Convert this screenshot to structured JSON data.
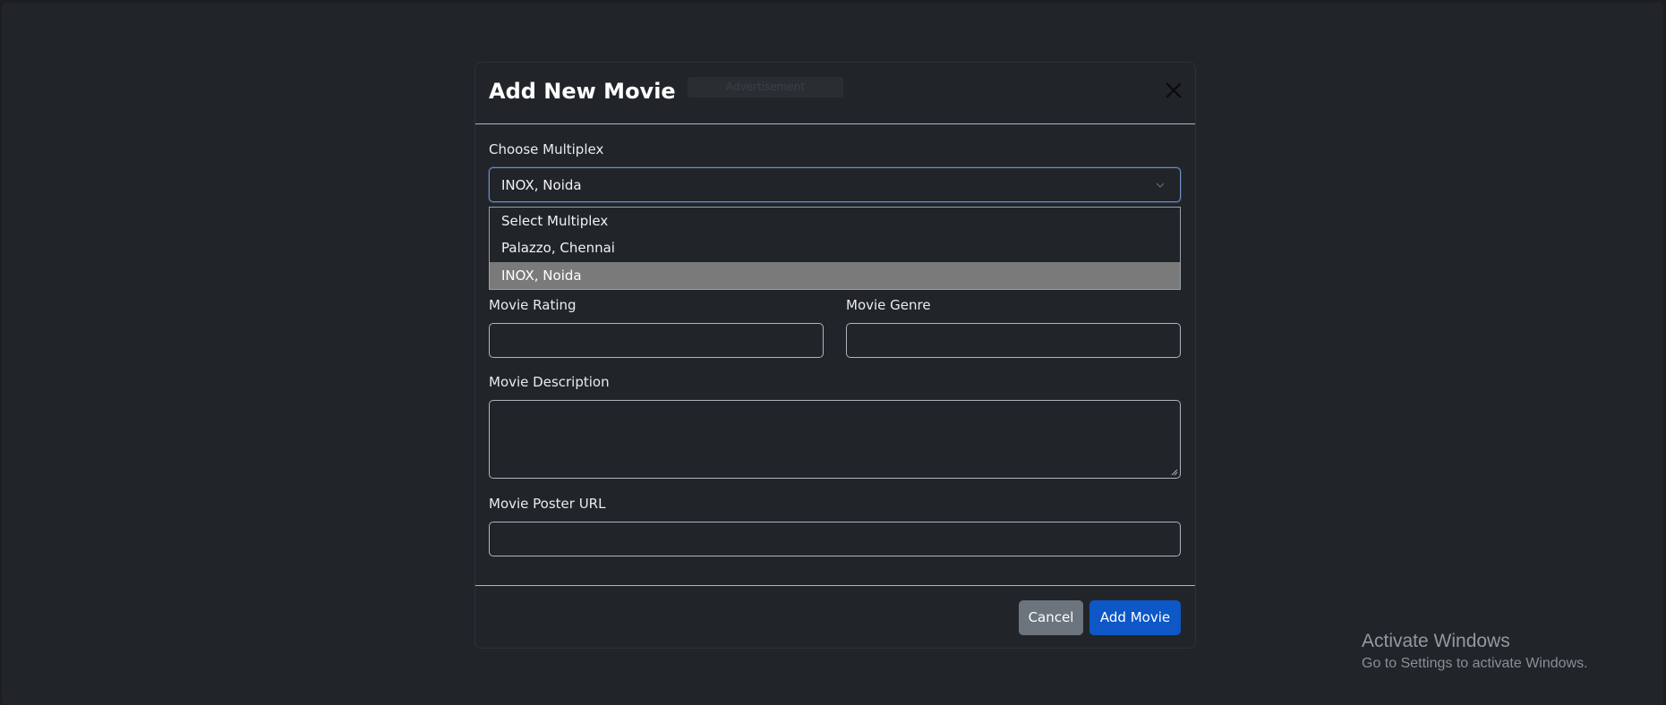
{
  "modal": {
    "title": "Add New Movie",
    "header_ghost_text": "Advertisement"
  },
  "multiplex": {
    "label": "Choose Multiplex",
    "selected": "INOX, Noida",
    "options": [
      "Select Multiplex",
      "Palazzo, Chennai",
      "INOX, Noida"
    ]
  },
  "fields": {
    "rating_label": "Movie Rating",
    "genre_label": "Movie Genre",
    "description_label": "Movie Description",
    "poster_label": "Movie Poster URL",
    "rating_value": "",
    "genre_value": "",
    "description_value": "",
    "poster_value": ""
  },
  "footer": {
    "cancel_label": "Cancel",
    "add_label": "Add Movie"
  },
  "watermark": {
    "title": "Activate Windows",
    "subtitle": "Go to Settings to activate Windows."
  },
  "colors": {
    "background": "#212428",
    "modal_bg": "#212529",
    "primary": "#0d57c6",
    "secondary": "#6c757d",
    "selected_option": "#7a7a7a",
    "focus_border": "#6d8fc9"
  },
  "icons": {
    "close": "close-icon",
    "dropdown": "chevron-down-icon"
  }
}
